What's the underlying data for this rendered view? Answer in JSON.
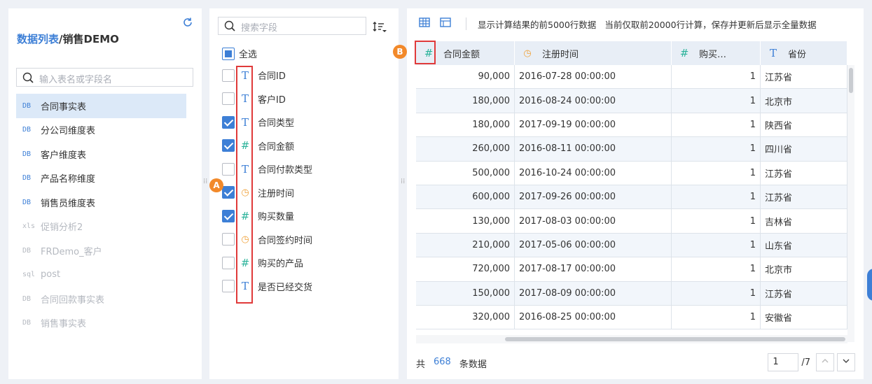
{
  "left": {
    "title_prefix": "数据列表",
    "title_suffix": "/销售DEMO",
    "search_placeholder": "输入表名或字段名",
    "tables": [
      {
        "icon": "DB",
        "label": "合同事实表",
        "state": "active"
      },
      {
        "icon": "DB",
        "label": "分公司维度表",
        "state": "normal"
      },
      {
        "icon": "DB",
        "label": "客户维度表",
        "state": "normal"
      },
      {
        "icon": "DB",
        "label": "产品名称维度",
        "state": "normal"
      },
      {
        "icon": "DB",
        "label": "销售员维度表",
        "state": "normal"
      },
      {
        "icon": "xls",
        "label": "促销分析2",
        "state": "dim"
      },
      {
        "icon": "DB",
        "label": "FRDemo_客户",
        "state": "dim"
      },
      {
        "icon": "sql",
        "label": "post",
        "state": "dim"
      },
      {
        "icon": "DB",
        "label": "合同回款事实表",
        "state": "dim"
      },
      {
        "icon": "DB",
        "label": "销售事实表",
        "state": "dim"
      }
    ]
  },
  "mid": {
    "search_placeholder": "搜索字段",
    "select_all_label": "全选",
    "fields": [
      {
        "type": "text",
        "label": "合同ID",
        "checked": false
      },
      {
        "type": "text",
        "label": "客户ID",
        "checked": false
      },
      {
        "type": "text",
        "label": "合同类型",
        "checked": true
      },
      {
        "type": "number",
        "label": "合同金额",
        "checked": true
      },
      {
        "type": "text",
        "label": "合同付款类型",
        "checked": false
      },
      {
        "type": "date",
        "label": "注册时间",
        "checked": true
      },
      {
        "type": "number",
        "label": "购买数量",
        "checked": true
      },
      {
        "type": "date",
        "label": "合同签约时间",
        "checked": false
      },
      {
        "type": "number",
        "label": "购买的产品",
        "checked": false
      },
      {
        "type": "text",
        "label": "是否已经交货",
        "checked": false
      }
    ],
    "marker_a": "A"
  },
  "right": {
    "toolbar_text1": "显示计算结果的前5000行数据",
    "toolbar_text2": "当前仅取前20000行计算，保存并更新后显示全量数据",
    "marker_b": "B",
    "columns": [
      {
        "type": "number",
        "label": "合同金额"
      },
      {
        "type": "date",
        "label": "注册时间"
      },
      {
        "type": "number",
        "label": "购买…"
      },
      {
        "type": "text",
        "label": "省份"
      }
    ],
    "rows": [
      [
        "90,000",
        "2016-07-28 00:00:00",
        "1",
        "江苏省"
      ],
      [
        "180,000",
        "2016-08-24 00:00:00",
        "1",
        "北京市"
      ],
      [
        "180,000",
        "2017-09-19 00:00:00",
        "1",
        "陕西省"
      ],
      [
        "260,000",
        "2016-08-11 00:00:00",
        "1",
        "四川省"
      ],
      [
        "500,000",
        "2016-10-24 00:00:00",
        "1",
        "江苏省"
      ],
      [
        "600,000",
        "2017-09-26 00:00:00",
        "1",
        "江苏省"
      ],
      [
        "130,000",
        "2017-08-03 00:00:00",
        "1",
        "吉林省"
      ],
      [
        "210,000",
        "2017-05-06 00:00:00",
        "1",
        "山东省"
      ],
      [
        "720,000",
        "2017-08-17 00:00:00",
        "1",
        "北京市"
      ],
      [
        "150,000",
        "2017-08-09 00:00:00",
        "1",
        "江苏省"
      ],
      [
        "320,000",
        "2016-08-25 00:00:00",
        "1",
        "安徽省"
      ]
    ],
    "footer_prefix": "共",
    "footer_count": "668",
    "footer_suffix": "条数据",
    "page_current": "1",
    "page_total": "/7"
  }
}
